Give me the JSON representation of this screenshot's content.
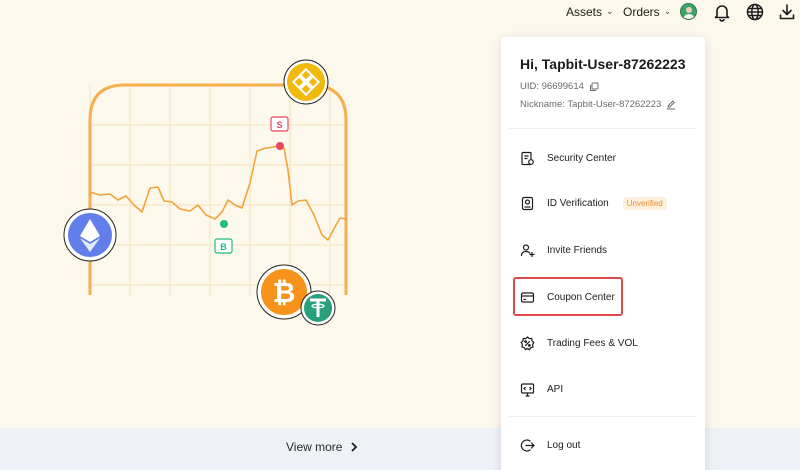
{
  "nav": {
    "assets_label": "Assets",
    "orders_label": "Orders",
    "chevron": "⌄"
  },
  "icons": {
    "top": [
      "avatar",
      "bell-icon",
      "globe-icon",
      "download-icon"
    ],
    "coins": [
      "bnb-coin-icon",
      "ethereum-coin-icon",
      "bitcoin-coin-icon",
      "tether-coin-icon"
    ]
  },
  "illustration": {
    "sell_marker": "S",
    "buy_marker": "B"
  },
  "footer": {
    "view_more": "View more",
    "arrow": "›"
  },
  "account": {
    "greeting": "Hi, Tapbit-User-87262223",
    "uid_label": "UID: 96699614",
    "nickname_label": "Nickname: Tapbit-User-87262223"
  },
  "menu": {
    "security": "Security Center",
    "id_verification": "ID Verification",
    "id_status": "Unverified",
    "invite": "Invite Friends",
    "coupon": "Coupon Center",
    "fees": "Trading Fees & VOL",
    "api": "API",
    "logout": "Log out"
  },
  "colors": {
    "background": "#fdf8ec",
    "chart_line": "#f0a43a",
    "sell": "#e8475a",
    "buy": "#1ebd7c",
    "bnb": "#f0b90b",
    "eth": "#627eea",
    "btc": "#f7931a",
    "usdt": "#26a17b",
    "highlight": "#de4a4a",
    "badge": "#e8912d"
  }
}
